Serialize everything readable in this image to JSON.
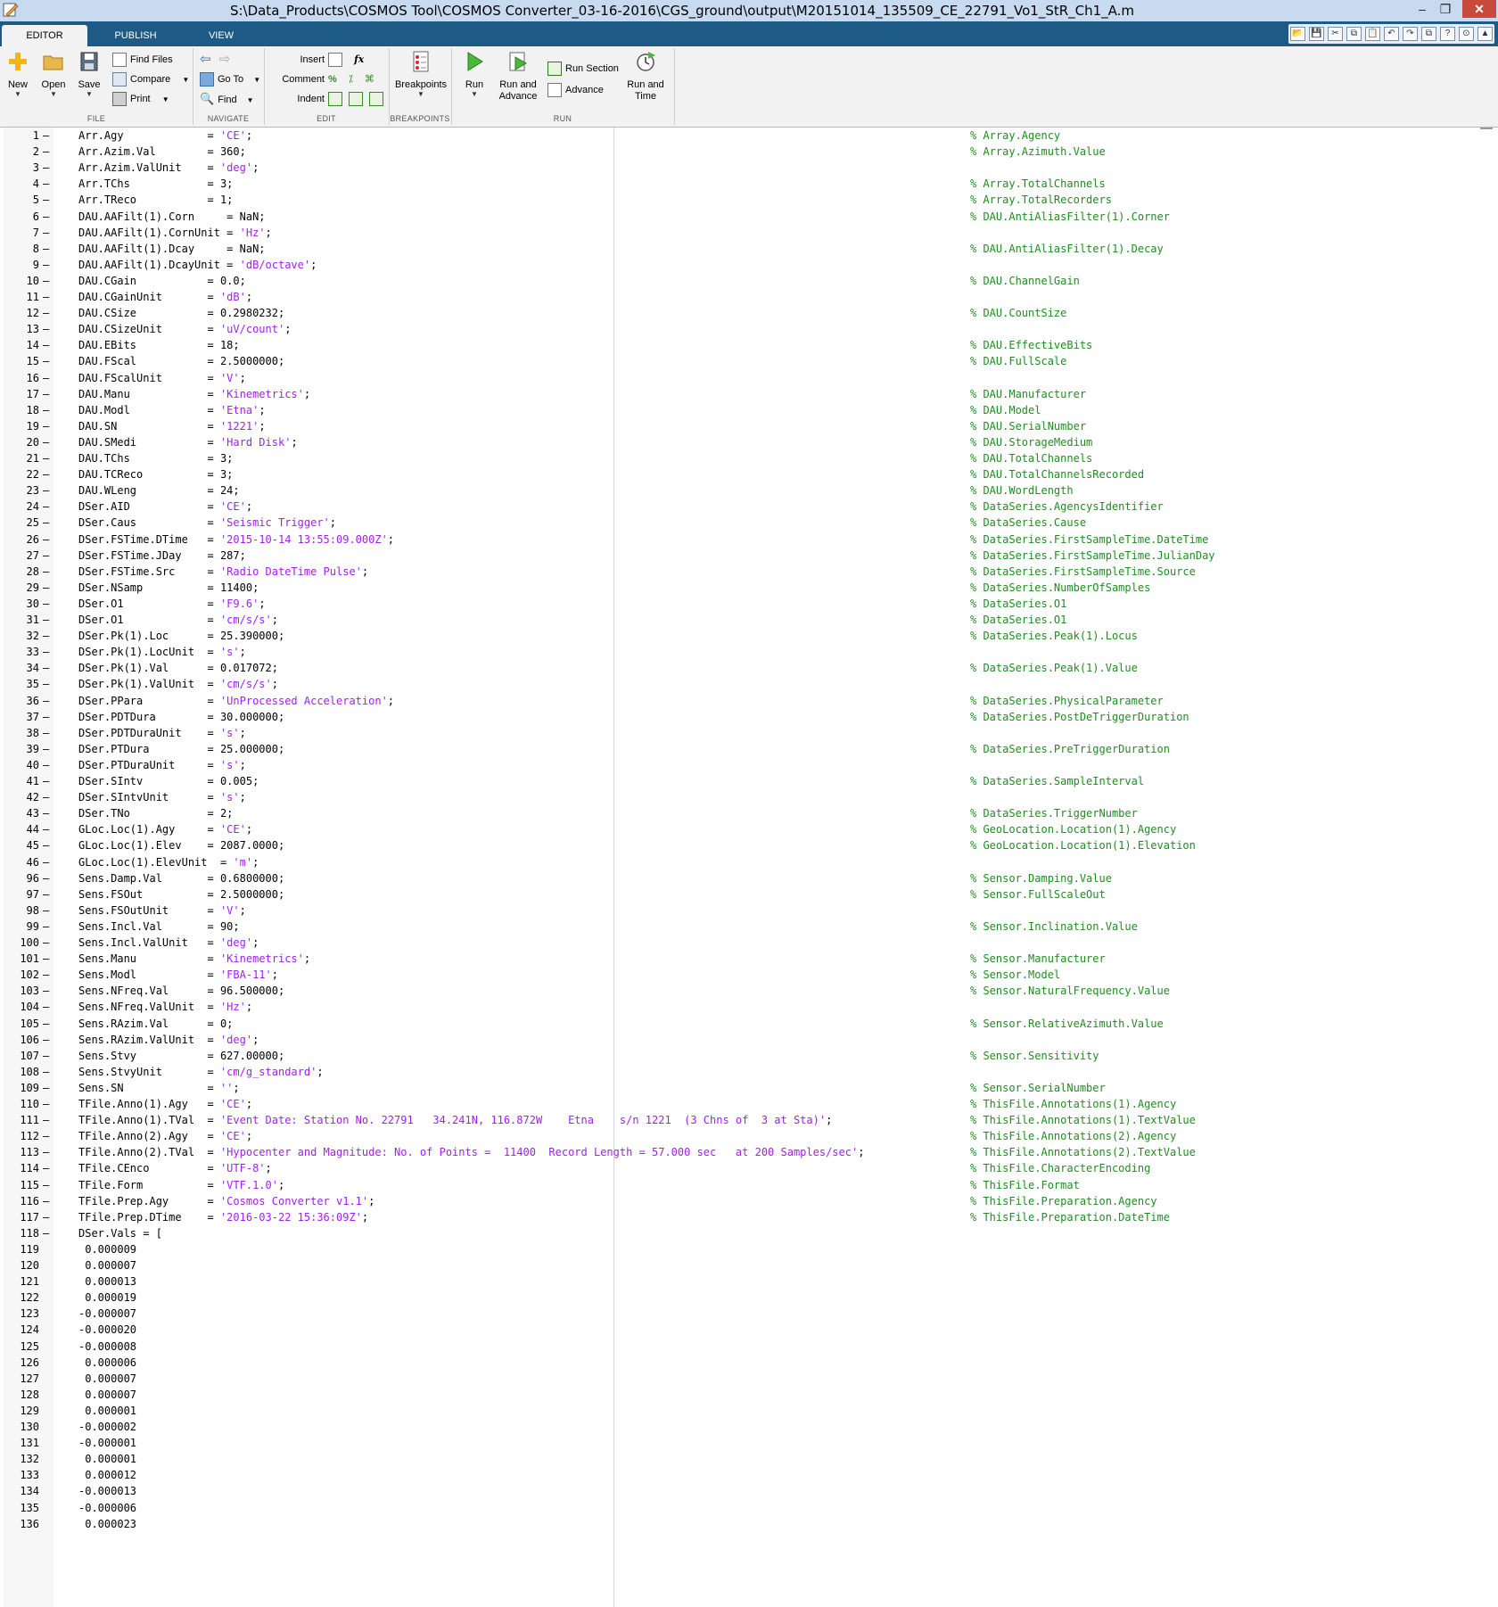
{
  "window": {
    "title": "S:\\Data_Products\\COSMOS Tool\\COSMOS Converter_03-16-2016\\CGS_ground\\output\\M20151014_135509_CE_22791_Vo1_StR_Ch1_A.m",
    "minimize": "–",
    "maximize": "❐",
    "close": "✕"
  },
  "tabs": [
    "EDITOR",
    "PUBLISH",
    "VIEW"
  ],
  "quick_access": [
    "📂",
    "💾",
    "✂",
    "⧉",
    "📋",
    "↶",
    "↷",
    "⧉",
    "?",
    "⊙",
    "▲"
  ],
  "ribbon": {
    "file": {
      "label": "FILE",
      "new": "New",
      "open": "Open",
      "save": "Save",
      "find_files": "Find Files",
      "compare": "Compare",
      "print": "Print"
    },
    "navigate": {
      "label": "NAVIGATE",
      "go_to": "Go To",
      "find": "Find"
    },
    "edit": {
      "label": "EDIT",
      "insert": "Insert",
      "comment": "Comment",
      "indent": "Indent",
      "fx": "fx"
    },
    "breakpoints": {
      "label": "BREAKPOINTS",
      "breakpoints": "Breakpoints"
    },
    "run": {
      "label": "RUN",
      "run": "Run",
      "run_and_advance_1": "Run and",
      "run_and_advance_2": "Advance",
      "run_section": "Run Section",
      "advance": "Advance",
      "run_and_time_1": "Run and",
      "run_and_time_2": "Time"
    }
  },
  "accent_colors": {
    "tabstrip": "#1d5a86",
    "comment": "#228b22",
    "string": "#a020f0",
    "close": "#c74a3a"
  },
  "lines": [
    {
      "n": "1",
      "d": true,
      "s": "Arr.Agy             = ",
      "v": "'CE'",
      "e": ";",
      "c": "% Array.Agency"
    },
    {
      "n": "2",
      "d": true,
      "s": "Arr.Azim.Val        = 360;",
      "c": "% Array.Azimuth.Value"
    },
    {
      "n": "3",
      "d": true,
      "s": "Arr.Azim.ValUnit    = ",
      "v": "'deg'",
      "e": ";",
      "c": ""
    },
    {
      "n": "4",
      "d": true,
      "s": "Arr.TChs            = 3;",
      "c": "% Array.TotalChannels"
    },
    {
      "n": "5",
      "d": true,
      "s": "Arr.TReco           = 1;",
      "c": "% Array.TotalRecorders"
    },
    {
      "n": "6",
      "d": true,
      "s": "DAU.AAFilt(1).Corn     = NaN;",
      "c": "% DAU.AntiAliasFilter(1).Corner"
    },
    {
      "n": "7",
      "d": true,
      "s": "DAU.AAFilt(1).CornUnit = ",
      "v": "'Hz'",
      "e": ";",
      "c": ""
    },
    {
      "n": "8",
      "d": true,
      "s": "DAU.AAFilt(1).Dcay     = NaN;",
      "c": "% DAU.AntiAliasFilter(1).Decay"
    },
    {
      "n": "9",
      "d": true,
      "s": "DAU.AAFilt(1).DcayUnit = ",
      "v": "'dB/octave'",
      "e": ";",
      "c": ""
    },
    {
      "n": "10",
      "d": true,
      "s": "DAU.CGain           = 0.0;",
      "c": "% DAU.ChannelGain"
    },
    {
      "n": "11",
      "d": true,
      "s": "DAU.CGainUnit       = ",
      "v": "'dB'",
      "e": ";",
      "c": ""
    },
    {
      "n": "12",
      "d": true,
      "s": "DAU.CSize           = 0.2980232;",
      "c": "% DAU.CountSize"
    },
    {
      "n": "13",
      "d": true,
      "s": "DAU.CSizeUnit       = ",
      "v": "'uV/count'",
      "e": ";",
      "c": ""
    },
    {
      "n": "14",
      "d": true,
      "s": "DAU.EBits           = 18;",
      "c": "% DAU.EffectiveBits"
    },
    {
      "n": "15",
      "d": true,
      "s": "DAU.FScal           = 2.5000000;",
      "c": "% DAU.FullScale"
    },
    {
      "n": "16",
      "d": true,
      "s": "DAU.FScalUnit       = ",
      "v": "'V'",
      "e": ";",
      "c": ""
    },
    {
      "n": "17",
      "d": true,
      "s": "DAU.Manu            = ",
      "v": "'Kinemetrics'",
      "e": ";",
      "c": "% DAU.Manufacturer"
    },
    {
      "n": "18",
      "d": true,
      "s": "DAU.Modl            = ",
      "v": "'Etna'",
      "e": ";",
      "c": "% DAU.Model"
    },
    {
      "n": "19",
      "d": true,
      "s": "DAU.SN              = ",
      "v": "'1221'",
      "e": ";",
      "c": "% DAU.SerialNumber"
    },
    {
      "n": "20",
      "d": true,
      "s": "DAU.SMedi           = ",
      "v": "'Hard Disk'",
      "e": ";",
      "c": "% DAU.StorageMedium"
    },
    {
      "n": "21",
      "d": true,
      "s": "DAU.TChs            = 3;",
      "c": "% DAU.TotalChannels"
    },
    {
      "n": "22",
      "d": true,
      "s": "DAU.TCReco          = 3;",
      "c": "% DAU.TotalChannelsRecorded"
    },
    {
      "n": "23",
      "d": true,
      "s": "DAU.WLeng           = 24;",
      "c": "% DAU.WordLength"
    },
    {
      "n": "24",
      "d": true,
      "s": "DSer.AID            = ",
      "v": "'CE'",
      "e": ";",
      "c": "% DataSeries.AgencysIdentifier"
    },
    {
      "n": "25",
      "d": true,
      "s": "DSer.Caus           = ",
      "v": "'Seismic Trigger'",
      "e": ";",
      "c": "% DataSeries.Cause"
    },
    {
      "n": "26",
      "d": true,
      "s": "DSer.FSTime.DTime   = ",
      "v": "'2015-10-14 13:55:09.000Z'",
      "e": ";",
      "c": "% DataSeries.FirstSampleTime.DateTime"
    },
    {
      "n": "27",
      "d": true,
      "s": "DSer.FSTime.JDay    = 287;",
      "c": "% DataSeries.FirstSampleTime.JulianDay"
    },
    {
      "n": "28",
      "d": true,
      "s": "DSer.FSTime.Src     = ",
      "v": "'Radio DateTime Pulse'",
      "e": ";",
      "c": "% DataSeries.FirstSampleTime.Source"
    },
    {
      "n": "29",
      "d": true,
      "s": "DSer.NSamp          = 11400;",
      "c": "% DataSeries.NumberOfSamples"
    },
    {
      "n": "30",
      "d": true,
      "s": "DSer.O1             = ",
      "v": "'F9.6'",
      "e": ";",
      "c": "% DataSeries.O1"
    },
    {
      "n": "31",
      "d": true,
      "s": "DSer.O1             = ",
      "v": "'cm/s/s'",
      "e": ";",
      "c": "% DataSeries.O1"
    },
    {
      "n": "32",
      "d": true,
      "s": "DSer.Pk(1).Loc      = 25.390000;",
      "c": "% DataSeries.Peak(1).Locus"
    },
    {
      "n": "33",
      "d": true,
      "s": "DSer.Pk(1).LocUnit  = ",
      "v": "'s'",
      "e": ";",
      "c": ""
    },
    {
      "n": "34",
      "d": true,
      "s": "DSer.Pk(1).Val      = 0.017072;",
      "c": "% DataSeries.Peak(1).Value"
    },
    {
      "n": "35",
      "d": true,
      "s": "DSer.Pk(1).ValUnit  = ",
      "v": "'cm/s/s'",
      "e": ";",
      "c": ""
    },
    {
      "n": "36",
      "d": true,
      "s": "DSer.PPara          = ",
      "v": "'UnProcessed Acceleration'",
      "e": ";",
      "c": "% DataSeries.PhysicalParameter"
    },
    {
      "n": "37",
      "d": true,
      "s": "DSer.PDTDura        = 30.000000;",
      "c": "% DataSeries.PostDeTriggerDuration"
    },
    {
      "n": "38",
      "d": true,
      "s": "DSer.PDTDuraUnit    = ",
      "v": "'s'",
      "e": ";",
      "c": ""
    },
    {
      "n": "39",
      "d": true,
      "s": "DSer.PTDura         = 25.000000;",
      "c": "% DataSeries.PreTriggerDuration"
    },
    {
      "n": "40",
      "d": true,
      "s": "DSer.PTDuraUnit     = ",
      "v": "'s'",
      "e": ";",
      "c": ""
    },
    {
      "n": "41",
      "d": true,
      "s": "DSer.SIntv          = 0.005;",
      "c": "% DataSeries.SampleInterval"
    },
    {
      "n": "42",
      "d": true,
      "s": "DSer.SIntvUnit      = ",
      "v": "'s'",
      "e": ";",
      "c": ""
    },
    {
      "n": "43",
      "d": true,
      "s": "DSer.TNo            = 2;",
      "c": "% DataSeries.TriggerNumber"
    },
    {
      "n": "44",
      "d": true,
      "s": "GLoc.Loc(1).Agy     = ",
      "v": "'CE'",
      "e": ";",
      "c": "% GeoLocation.Location(1).Agency"
    },
    {
      "n": "45",
      "d": true,
      "s": "GLoc.Loc(1).Elev    = 2087.0000;",
      "c": "% GeoLocation.Location(1).Elevation"
    },
    {
      "n": "46",
      "d": true,
      "s": "GLoc.Loc(1).ElevUnit  = ",
      "v": "'m'",
      "e": ";",
      "c": ""
    },
    {
      "n": "96",
      "d": true,
      "s": "Sens.Damp.Val       = 0.6800000;",
      "c": "% Sensor.Damping.Value"
    },
    {
      "n": "97",
      "d": true,
      "s": "Sens.FSOut          = 2.5000000;",
      "c": "% Sensor.FullScaleOut"
    },
    {
      "n": "98",
      "d": true,
      "s": "Sens.FSOutUnit      = ",
      "v": "'V'",
      "e": ";",
      "c": ""
    },
    {
      "n": "99",
      "d": true,
      "s": "Sens.Incl.Val       = 90;",
      "c": "% Sensor.Inclination.Value"
    },
    {
      "n": "100",
      "d": true,
      "s": "Sens.Incl.ValUnit   = ",
      "v": "'deg'",
      "e": ";",
      "c": ""
    },
    {
      "n": "101",
      "d": true,
      "s": "Sens.Manu           = ",
      "v": "'Kinemetrics'",
      "e": ";",
      "c": "% Sensor.Manufacturer"
    },
    {
      "n": "102",
      "d": true,
      "s": "Sens.Modl           = ",
      "v": "'FBA-11'",
      "e": ";",
      "c": "% Sensor.Model"
    },
    {
      "n": "103",
      "d": true,
      "s": "Sens.NFreq.Val      = 96.500000;",
      "c": "% Sensor.NaturalFrequency.Value"
    },
    {
      "n": "104",
      "d": true,
      "s": "Sens.NFreq.ValUnit  = ",
      "v": "'Hz'",
      "e": ";",
      "c": ""
    },
    {
      "n": "105",
      "d": true,
      "s": "Sens.RAzim.Val      = 0;",
      "c": "% Sensor.RelativeAzimuth.Value"
    },
    {
      "n": "106",
      "d": true,
      "s": "Sens.RAzim.ValUnit  = ",
      "v": "'deg'",
      "e": ";",
      "c": ""
    },
    {
      "n": "107",
      "d": true,
      "s": "Sens.Stvy           = 627.00000;",
      "c": "% Sensor.Sensitivity"
    },
    {
      "n": "108",
      "d": true,
      "s": "Sens.StvyUnit       = ",
      "v": "'cm/g_standard'",
      "e": ";",
      "c": ""
    },
    {
      "n": "109",
      "d": true,
      "s": "Sens.SN             = ",
      "v": "''",
      "e": ";",
      "c": "% Sensor.SerialNumber"
    },
    {
      "n": "110",
      "d": true,
      "s": "TFile.Anno(1).Agy   = ",
      "v": "'CE'",
      "e": ";",
      "c": "% ThisFile.Annotations(1).Agency"
    },
    {
      "n": "111",
      "d": true,
      "s": "TFile.Anno(1).TVal  = ",
      "v": "'Event Date: Station No. 22791   34.241N, 116.872W    Etna    s/n 1221  (3 Chns of  3 at Sta)'",
      "e": ";",
      "c": "% ThisFile.Annotations(1).TextValue"
    },
    {
      "n": "112",
      "d": true,
      "s": "TFile.Anno(2).Agy   = ",
      "v": "'CE'",
      "e": ";",
      "c": "% ThisFile.Annotations(2).Agency"
    },
    {
      "n": "113",
      "d": true,
      "s": "TFile.Anno(2).TVal  = ",
      "v": "'Hypocenter and Magnitude: No. of Points =  11400  Record Length = 57.000 sec   at 200 Samples/sec'",
      "e": ";",
      "c": "% ThisFile.Annotations(2).TextValue"
    },
    {
      "n": "114",
      "d": true,
      "s": "TFile.CEnco         = ",
      "v": "'UTF-8'",
      "e": ";",
      "c": "% ThisFile.CharacterEncoding"
    },
    {
      "n": "115",
      "d": true,
      "s": "TFile.Form          = ",
      "v": "'VTF.1.0'",
      "e": ";",
      "c": "% ThisFile.Format"
    },
    {
      "n": "116",
      "d": true,
      "s": "TFile.Prep.Agy      = ",
      "v": "'Cosmos Converter v1.1'",
      "e": ";",
      "c": "% ThisFile.Preparation.Agency"
    },
    {
      "n": "117",
      "d": true,
      "s": "TFile.Prep.DTime    = ",
      "v": "'2016-03-22 15:36:09Z'",
      "e": ";",
      "c": "% ThisFile.Preparation.DateTime"
    },
    {
      "n": "118",
      "d": true,
      "s": "DSer.Vals = [",
      "c": ""
    },
    {
      "n": "119",
      "d": false,
      "s": " 0.000009",
      "c": ""
    },
    {
      "n": "120",
      "d": false,
      "s": " 0.000007",
      "c": ""
    },
    {
      "n": "121",
      "d": false,
      "s": " 0.000013",
      "c": ""
    },
    {
      "n": "122",
      "d": false,
      "s": " 0.000019",
      "c": ""
    },
    {
      "n": "123",
      "d": false,
      "s": "-0.000007",
      "c": ""
    },
    {
      "n": "124",
      "d": false,
      "s": "-0.000020",
      "c": ""
    },
    {
      "n": "125",
      "d": false,
      "s": "-0.000008",
      "c": ""
    },
    {
      "n": "126",
      "d": false,
      "s": " 0.000006",
      "c": ""
    },
    {
      "n": "127",
      "d": false,
      "s": " 0.000007",
      "c": ""
    },
    {
      "n": "128",
      "d": false,
      "s": " 0.000007",
      "c": ""
    },
    {
      "n": "129",
      "d": false,
      "s": " 0.000001",
      "c": ""
    },
    {
      "n": "130",
      "d": false,
      "s": "-0.000002",
      "c": ""
    },
    {
      "n": "131",
      "d": false,
      "s": "-0.000001",
      "c": ""
    },
    {
      "n": "132",
      "d": false,
      "s": " 0.000001",
      "c": ""
    },
    {
      "n": "133",
      "d": false,
      "s": " 0.000012",
      "c": ""
    },
    {
      "n": "134",
      "d": false,
      "s": "-0.000013",
      "c": ""
    },
    {
      "n": "135",
      "d": false,
      "s": "-0.000006",
      "c": ""
    },
    {
      "n": "136",
      "d": false,
      "s": " 0.000023",
      "c": ""
    }
  ]
}
